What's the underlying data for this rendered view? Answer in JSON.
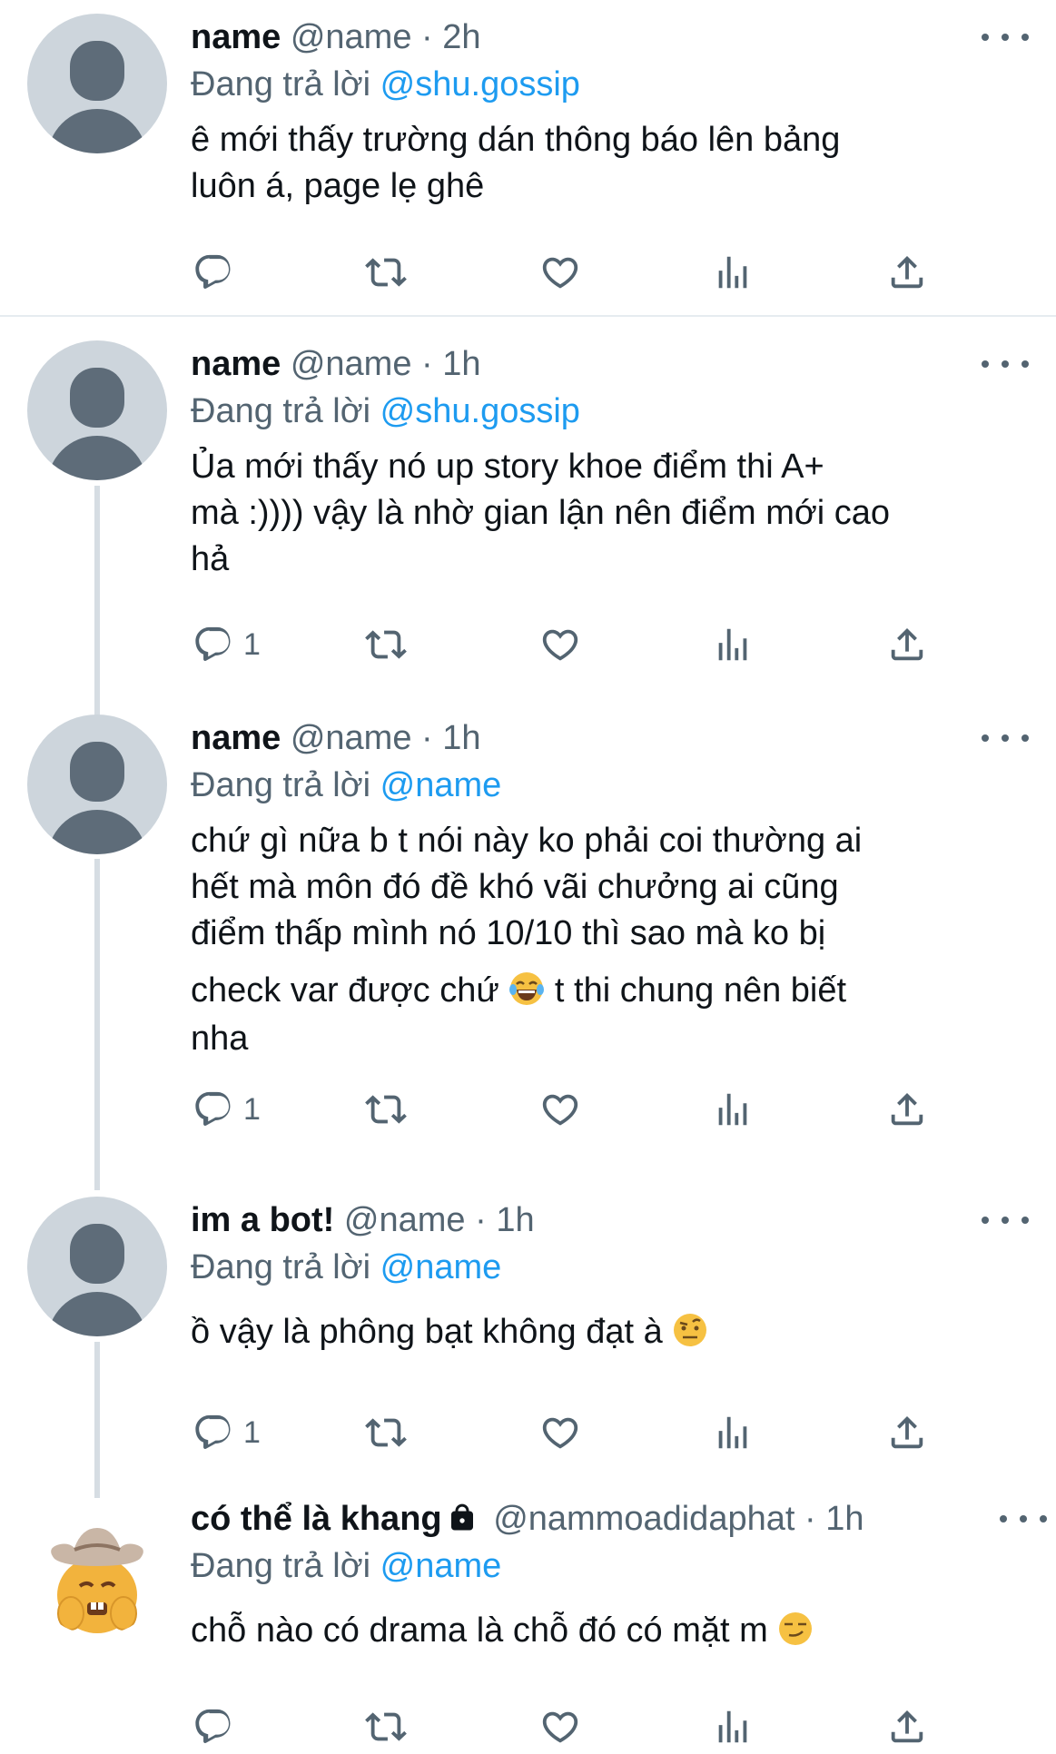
{
  "tweets": [
    {
      "display_name": "name",
      "handle": "@name",
      "time": "2h",
      "reply_label": "Đang trả lời",
      "reply_to": "@shu.gossip",
      "text_lines": [
        "ê mới thấy trường dán thông báo lên bảng",
        "luôn á, page lẹ ghê"
      ],
      "reply_count": "",
      "avatar": "default-avatar"
    },
    {
      "display_name": "name",
      "handle": "@name",
      "time": "1h",
      "reply_label": "Đang trả lời",
      "reply_to": "@shu.gossip",
      "text_lines": [
        "Ủa mới thấy nó up story khoe điểm thi A+",
        "mà :)))) vậy là nhờ gian lận nên điểm mới cao",
        "hả"
      ],
      "reply_count": "1",
      "avatar": "default-avatar"
    },
    {
      "display_name": "name",
      "handle": "@name",
      "time": "1h",
      "reply_label": "Đang trả lời",
      "reply_to": "@name",
      "text_lines": [
        "chứ gì nữa b t nói này ko phải coi thường ai",
        "hết mà môn đó đề khó vãi chưởng ai cũng",
        "điểm thấp mình nó 10/10 thì sao mà ko bị"
      ],
      "text_line_emoji_before": "check var được chứ",
      "text_line_emoji_after": "t thi chung nên biết",
      "text_last": "nha",
      "emoji": "tears-of-joy-emoji",
      "reply_count": "1",
      "avatar": "default-avatar"
    },
    {
      "display_name": "im a bot!",
      "handle": "@name",
      "time": "1h",
      "reply_label": "Đang trả lời",
      "reply_to": "@name",
      "text": "ồ vậy là phông bạt không đạt à",
      "emoji": "raised-eyebrow-emoji",
      "reply_count": "1",
      "avatar": "default-avatar"
    },
    {
      "display_name": "có thể là khang",
      "handle": "@nammoadidaphat",
      "time": "1h",
      "reply_label": "Đang trả lời",
      "reply_to": "@name",
      "text": "chỗ nào có drama là chỗ đó có mặt m",
      "emoji": "smirking-face-emoji",
      "reply_count": "",
      "avatar": "cowboy-emoji-avatar",
      "locked": true
    }
  ],
  "icons": {
    "reply": "reply-icon",
    "retweet": "retweet-icon",
    "like": "heart-icon",
    "views": "views-icon",
    "share": "share-icon",
    "more": "more-icon",
    "lock": "lock-icon"
  },
  "colors": {
    "accent": "#1d9bf0",
    "secondary_text": "#536471",
    "avatar_bg": "#cdd5dc"
  }
}
